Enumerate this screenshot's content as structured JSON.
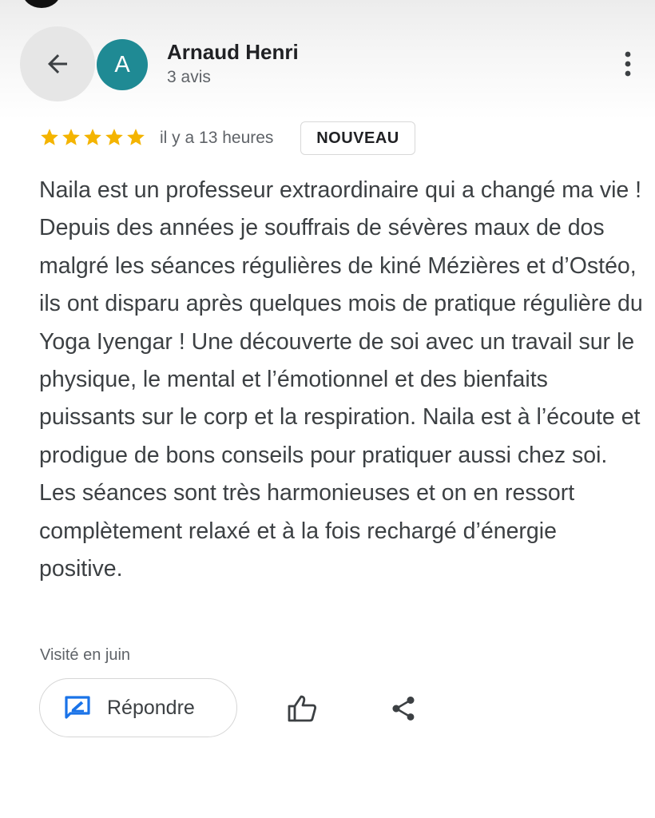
{
  "author": {
    "initial": "A",
    "name": "Arnaud Henri",
    "review_count": "3 avis",
    "avatar_color": "#1f8a94"
  },
  "review": {
    "rating": 5,
    "rating_max": 5,
    "star_color": "#f4b400",
    "time": "il y a 13 heures",
    "badge": "NOUVEAU",
    "text": "Naila est un professeur extraordinaire qui a changé ma vie ! Depuis des années je souffrais de sévères maux de dos malgré les séances régulières de kiné Mézières et d’Ostéo, ils ont disparu après quelques mois de pratique régulière du Yoga Iyengar ! Une découverte de soi avec un travail sur le physique, le mental et l’émotionnel et des bienfaits puissants sur le corp et la respiration. Naila est à l’écoute et prodigue de bons conseils pour pratiquer aussi chez soi. Les séances sont très harmonieuses et on en ressort complètement relaxé et à la fois rechargé d’énergie positive.",
    "visited": "Visité en juin"
  },
  "actions": {
    "reply_label": "Répondre",
    "reply_icon": "reply-edit-icon",
    "like_icon": "thumb-up-icon",
    "share_icon": "share-icon",
    "accent_color": "#1a73e8"
  },
  "header": {
    "back_icon": "arrow-left-icon",
    "menu_icon": "more-vertical-icon"
  }
}
